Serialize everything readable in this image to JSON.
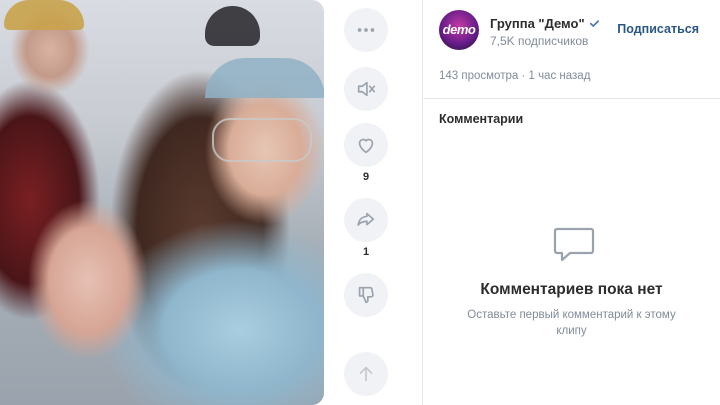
{
  "actions": {
    "more_icon": "more-icon",
    "mute_icon": "speaker-muted-icon",
    "like_icon": "heart-icon",
    "likes_count": "9",
    "share_icon": "share-arrow-icon",
    "shares_count": "1",
    "dislike_icon": "thumb-down-icon",
    "up_icon": "arrow-up-icon"
  },
  "group": {
    "avatar_text": "demo",
    "name": "Группа \"Демо\"",
    "subscribers": "7,5K подписчиков",
    "subscribe_label": "Подписаться"
  },
  "clip": {
    "meta": "143 просмотра · 1 час назад"
  },
  "comments": {
    "title": "Комментарии",
    "empty_title": "Комментариев пока нет",
    "empty_subtitle": "Оставьте первый комментарий к этому клипу"
  },
  "colors": {
    "accent": "#2a5885",
    "button_bg": "#f0f2f5",
    "icon": "#99a2ad",
    "muted_text": "#818c99",
    "verified": "#4a76a8"
  }
}
